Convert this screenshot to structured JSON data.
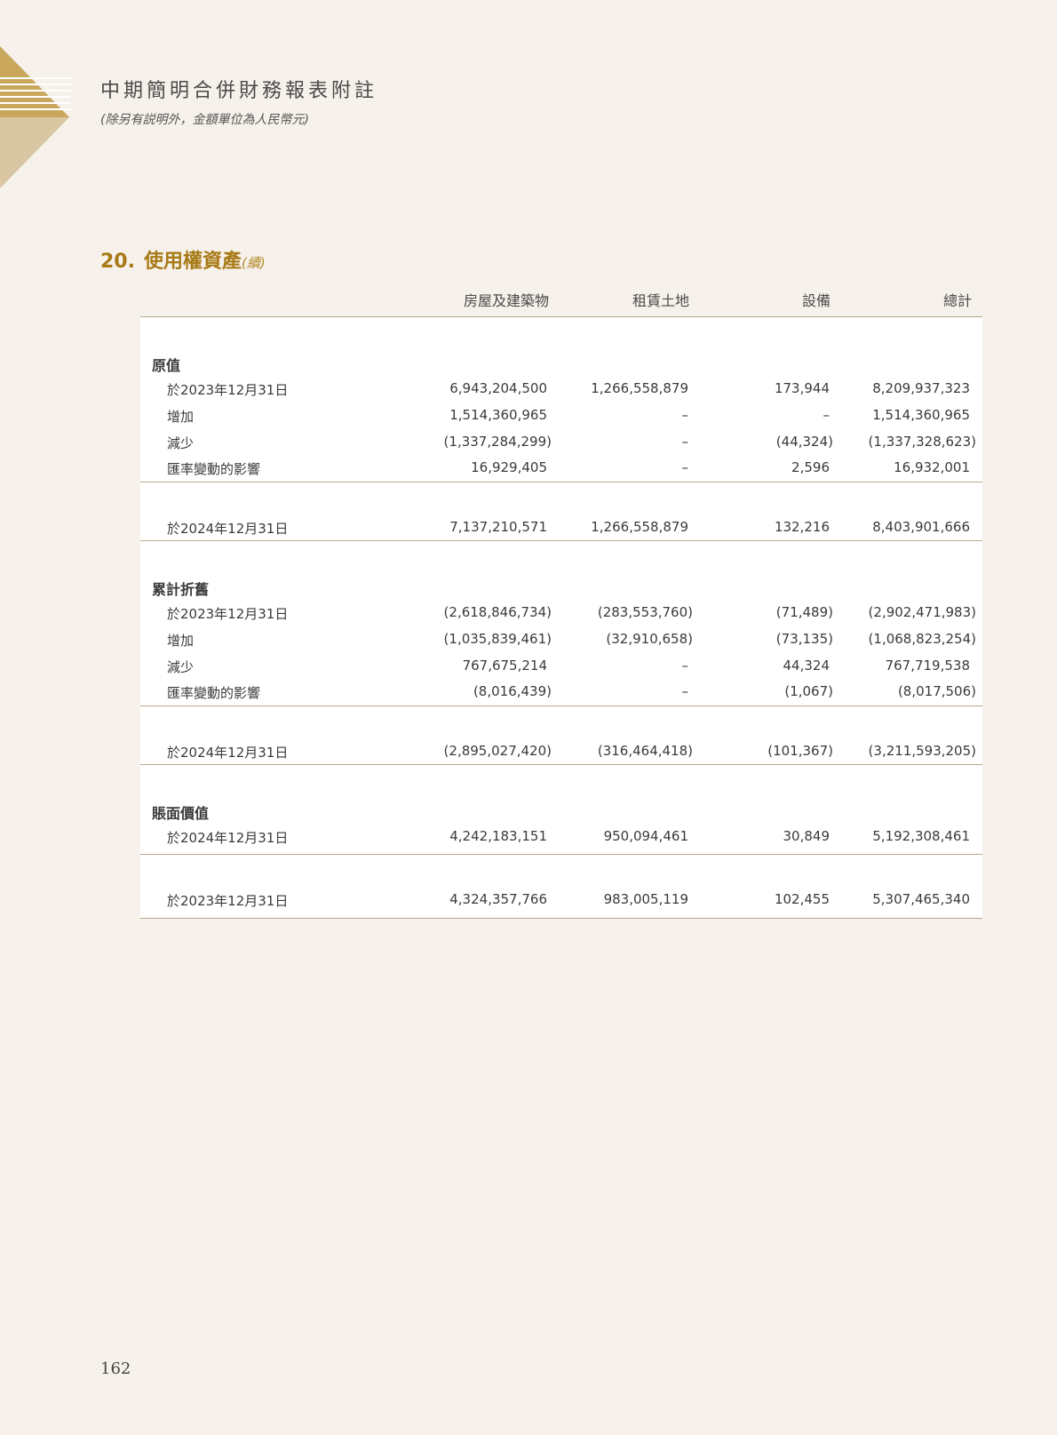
{
  "header": {
    "title": "中期簡明合併財務報表附註",
    "subtitle": "(除另有説明外，金額單位為人民幣元)"
  },
  "section": {
    "number": "20.",
    "title": "使用權資產",
    "continued": "(續)"
  },
  "columns": [
    "房屋及建築物",
    "租賃土地",
    "設備",
    "總計"
  ],
  "groups": {
    "cost": "原值",
    "depreciation": "累計折舊",
    "carrying": "賬面價值"
  },
  "rows": {
    "cost_open": {
      "label": "於2023年12月31日",
      "v": [
        "6,943,204,500",
        "1,266,558,879",
        "173,944",
        "8,209,937,323"
      ]
    },
    "cost_add": {
      "label": "增加",
      "v": [
        "1,514,360,965",
        "–",
        "–",
        "1,514,360,965"
      ]
    },
    "cost_red": {
      "label": "減少",
      "v": [
        "(1,337,284,299)",
        "–",
        "(44,324)",
        "(1,337,328,623)"
      ]
    },
    "cost_fx": {
      "label": "匯率變動的影響",
      "v": [
        "16,929,405",
        "–",
        "2,596",
        "16,932,001"
      ]
    },
    "cost_close": {
      "label": "於2024年12月31日",
      "v": [
        "7,137,210,571",
        "1,266,558,879",
        "132,216",
        "8,403,901,666"
      ]
    },
    "dep_open": {
      "label": "於2023年12月31日",
      "v": [
        "(2,618,846,734)",
        "(283,553,760)",
        "(71,489)",
        "(2,902,471,983)"
      ]
    },
    "dep_add": {
      "label": "增加",
      "v": [
        "(1,035,839,461)",
        "(32,910,658)",
        "(73,135)",
        "(1,068,823,254)"
      ]
    },
    "dep_red": {
      "label": "減少",
      "v": [
        "767,675,214",
        "–",
        "44,324",
        "767,719,538"
      ]
    },
    "dep_fx": {
      "label": "匯率變動的影響",
      "v": [
        "(8,016,439)",
        "–",
        "(1,067)",
        "(8,017,506)"
      ]
    },
    "dep_close": {
      "label": "於2024年12月31日",
      "v": [
        "(2,895,027,420)",
        "(316,464,418)",
        "(101,367)",
        "(3,211,593,205)"
      ]
    },
    "cv_2024": {
      "label": "於2024年12月31日",
      "v": [
        "4,242,183,151",
        "950,094,461",
        "30,849",
        "5,192,308,461"
      ]
    },
    "cv_2023": {
      "label": "於2023年12月31日",
      "v": [
        "4,324,357,766",
        "983,005,119",
        "102,455",
        "5,307,465,340"
      ]
    }
  },
  "page_number": "162",
  "colors": {
    "accent": "#a87a17",
    "background": "#f6f1ea",
    "rule": "#b7a98f"
  }
}
